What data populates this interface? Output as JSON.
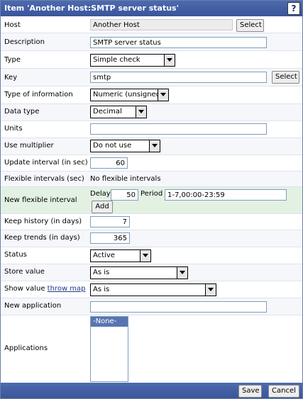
{
  "dialog": {
    "title": "Item 'Another Host:SMTP server status'",
    "help_icon": "?"
  },
  "fields": {
    "host": {
      "label": "Host",
      "value": "Another Host",
      "button": "Select"
    },
    "description": {
      "label": "Description",
      "value": "SMTP server status"
    },
    "type": {
      "label": "Type",
      "value": "Simple check"
    },
    "key": {
      "label": "Key",
      "value": "smtp",
      "button": "Select"
    },
    "type_of_information": {
      "label": "Type of information",
      "value": "Numeric (unsigned)"
    },
    "data_type": {
      "label": "Data type",
      "value": "Decimal"
    },
    "units": {
      "label": "Units",
      "value": ""
    },
    "use_multiplier": {
      "label": "Use multiplier",
      "value": "Do not use"
    },
    "update_interval": {
      "label": "Update interval (in sec)",
      "value": "60"
    },
    "flexible_intervals": {
      "label": "Flexible intervals (sec)",
      "value": "No flexible intervals"
    },
    "new_flexible_interval": {
      "label": "New flexible interval",
      "delay_label": "Delay",
      "delay_value": "50",
      "period_label": "Period",
      "period_value": "1-7,00:00-23:59",
      "add_button": "Add"
    },
    "keep_history": {
      "label": "Keep history (in days)",
      "value": "7"
    },
    "keep_trends": {
      "label": "Keep trends (in days)",
      "value": "365"
    },
    "status": {
      "label": "Status",
      "value": "Active"
    },
    "store_value": {
      "label": "Store value",
      "value": "As is"
    },
    "show_value": {
      "label": "Show value",
      "link": "throw map",
      "value": "As is"
    },
    "new_application": {
      "label": "New application",
      "value": ""
    },
    "applications": {
      "label": "Applications",
      "options": [
        "-None-"
      ]
    }
  },
  "footer": {
    "save_label": "Save",
    "cancel_label": "Cancel"
  },
  "colors": {
    "titlebar": "#3f5ca3",
    "highlight_row": "#e3f1e3",
    "selected_option": "#5975b1"
  }
}
